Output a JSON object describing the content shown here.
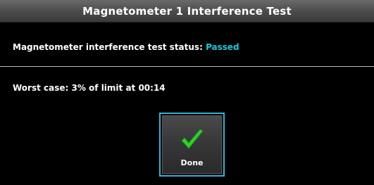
{
  "dialog": {
    "title": "Magnetometer 1 Interference Test",
    "status_label": "Magnetometer interference test status:",
    "status_value": "Passed",
    "worst_case": "Worst case: 3% of limit at 00:14"
  },
  "buttons": {
    "done_label": "Done",
    "done_icon": "check-icon"
  },
  "colors": {
    "status_value": "#17c8d8",
    "check": "#2fd12a",
    "button_border": "#2bb6d8"
  }
}
